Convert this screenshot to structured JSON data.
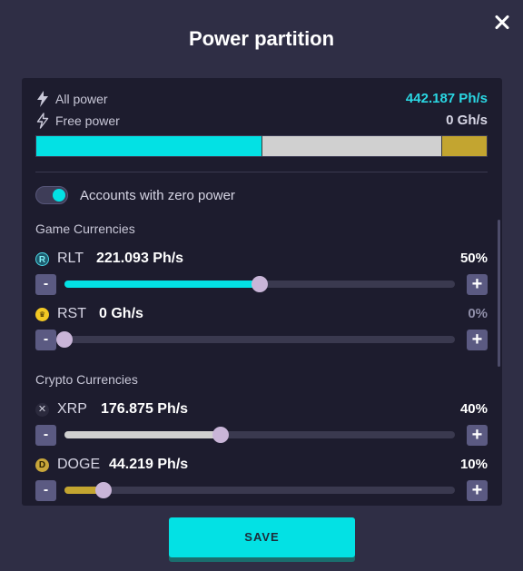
{
  "modal": {
    "title": "Power partition",
    "close_icon": "close-icon"
  },
  "power": {
    "all_label": "All power",
    "all_value": "442.187 Ph/s",
    "free_label": "Free power",
    "free_value": "0 Gh/s",
    "icon": "lightning-bolt-icon",
    "distribution_percent": {
      "rlt": 50,
      "xrp": 40,
      "doge": 10
    },
    "colors": {
      "rlt": "#03e1e4",
      "xrp": "#d0d0d0",
      "doge": "#c3a530",
      "accent": "#2ad7e3"
    }
  },
  "toggle": {
    "label": "Accounts with zero power",
    "on": true
  },
  "sections": {
    "game": "Game Currencies",
    "crypto": "Crypto Currencies"
  },
  "currencies": {
    "rlt": {
      "code": "RLT",
      "amount": "221.093 Ph/s",
      "percent": "50%",
      "level": 0.5,
      "color": "#03e1e4",
      "icon": "rlt-coin-icon"
    },
    "rst": {
      "code": "RST",
      "amount": "0 Gh/s",
      "percent": "0%",
      "level": 0.0,
      "color": "#03e1e4",
      "icon": "rst-coin-icon"
    },
    "xrp": {
      "code": "XRP",
      "amount": "176.875 Ph/s",
      "percent": "40%",
      "level": 0.4,
      "color": "#d0d0d0",
      "icon": "xrp-coin-icon"
    },
    "doge": {
      "code": "DOGE",
      "amount": "44.219 Ph/s",
      "percent": "10%",
      "level": 0.1,
      "color": "#c3a530",
      "icon": "doge-coin-icon"
    }
  },
  "buttons": {
    "minus": "-",
    "plus": "+",
    "save": "SAVE"
  }
}
